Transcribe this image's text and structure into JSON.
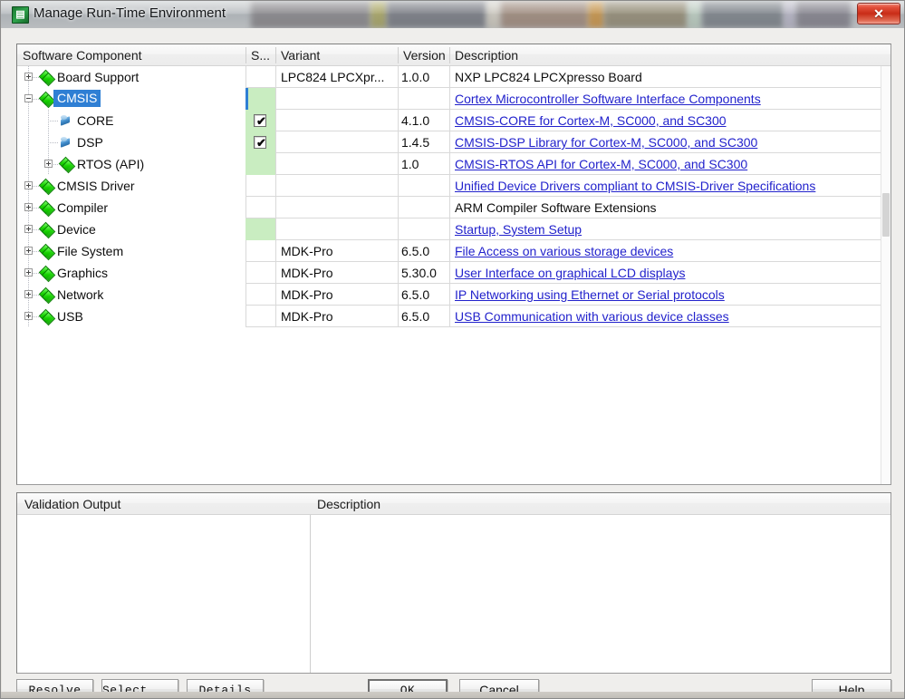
{
  "window": {
    "title": "Manage Run-Time Environment",
    "app_icon_glyph": "▤",
    "close_label": "✕",
    "accent_selection": "#2f7fd4",
    "accent_selected_cell": "#c9edc1",
    "link_color": "#2222cc"
  },
  "table": {
    "columns": [
      {
        "key": "component",
        "label": "Software Component"
      },
      {
        "key": "sel",
        "label": "S..."
      },
      {
        "key": "variant",
        "label": "Variant"
      },
      {
        "key": "version",
        "label": "Version"
      },
      {
        "key": "description",
        "label": "Description"
      }
    ],
    "rows": [
      {
        "name": "Board Support",
        "indent": 0,
        "expander": "plus",
        "icon": "component-diamond-icon",
        "selected": false,
        "sel_state": "none",
        "sel_green": false,
        "variant": "LPC824 LPCXpr...",
        "version": "1.0.0",
        "description": "NXP LPC824 LPCXpresso Board",
        "description_is_link": false
      },
      {
        "name": "CMSIS",
        "indent": 0,
        "expander": "minus",
        "icon": "component-diamond-icon",
        "selected": true,
        "sel_state": "none",
        "sel_green": true,
        "variant": "",
        "version": "",
        "description": "Cortex Microcontroller Software Interface Components",
        "description_is_link": true
      },
      {
        "name": "CORE",
        "indent": 1,
        "expander": "none",
        "icon": "api-cylinder-icon",
        "selected": false,
        "sel_state": "checked",
        "sel_green": true,
        "variant": "",
        "version": "4.1.0",
        "description": "CMSIS-CORE for Cortex-M, SC000, and SC300",
        "description_is_link": true
      },
      {
        "name": "DSP",
        "indent": 1,
        "expander": "none",
        "icon": "api-cylinder-icon",
        "selected": false,
        "sel_state": "checked",
        "sel_green": true,
        "variant": "",
        "version": "1.4.5",
        "description": "CMSIS-DSP Library for Cortex-M, SC000, and SC300",
        "description_is_link": true
      },
      {
        "name": "RTOS (API)",
        "indent": 1,
        "expander": "plus",
        "icon": "component-diamond-icon",
        "selected": false,
        "sel_state": "none",
        "sel_green": true,
        "variant": "",
        "version": "1.0",
        "description": "CMSIS-RTOS API for Cortex-M, SC000, and SC300",
        "description_is_link": true
      },
      {
        "name": "CMSIS Driver",
        "indent": 0,
        "expander": "plus",
        "icon": "component-diamond-icon",
        "selected": false,
        "sel_state": "none",
        "sel_green": false,
        "variant": "",
        "version": "",
        "description": "Unified Device Drivers compliant to CMSIS-Driver Specifications",
        "description_is_link": true
      },
      {
        "name": "Compiler",
        "indent": 0,
        "expander": "plus",
        "icon": "component-diamond-icon",
        "selected": false,
        "sel_state": "none",
        "sel_green": false,
        "variant": "",
        "version": "",
        "description": "ARM Compiler Software Extensions",
        "description_is_link": false
      },
      {
        "name": "Device",
        "indent": 0,
        "expander": "plus",
        "icon": "component-diamond-icon",
        "selected": false,
        "sel_state": "none",
        "sel_green": true,
        "variant": "",
        "version": "",
        "description": "Startup, System Setup",
        "description_is_link": true
      },
      {
        "name": "File System",
        "indent": 0,
        "expander": "plus",
        "icon": "component-diamond-icon",
        "selected": false,
        "sel_state": "none",
        "sel_green": false,
        "variant": "MDK-Pro",
        "version": "6.5.0",
        "description": "File Access on various storage devices",
        "description_is_link": true
      },
      {
        "name": "Graphics",
        "indent": 0,
        "expander": "plus",
        "icon": "component-diamond-icon",
        "selected": false,
        "sel_state": "none",
        "sel_green": false,
        "variant": "MDK-Pro",
        "version": "5.30.0",
        "description": "User Interface on graphical LCD displays",
        "description_is_link": true
      },
      {
        "name": "Network",
        "indent": 0,
        "expander": "plus",
        "icon": "component-diamond-icon",
        "selected": false,
        "sel_state": "none",
        "sel_green": false,
        "variant": "MDK-Pro",
        "version": "6.5.0",
        "description": "IP Networking using Ethernet or Serial protocols",
        "description_is_link": true
      },
      {
        "name": "USB",
        "indent": 0,
        "expander": "plus",
        "icon": "component-diamond-icon",
        "selected": false,
        "sel_state": "none",
        "sel_green": false,
        "variant": "MDK-Pro",
        "version": "6.5.0",
        "description": "USB Communication with various device classes",
        "description_is_link": true
      }
    ]
  },
  "validation": {
    "columns": [
      {
        "key": "output",
        "label": "Validation Output"
      },
      {
        "key": "description",
        "label": "Description"
      }
    ],
    "rows": []
  },
  "buttons": {
    "resolve": "Resolve",
    "select": "Select ...",
    "details": "Details",
    "ok": "OK",
    "cancel": "Cancel",
    "help": "Help"
  }
}
